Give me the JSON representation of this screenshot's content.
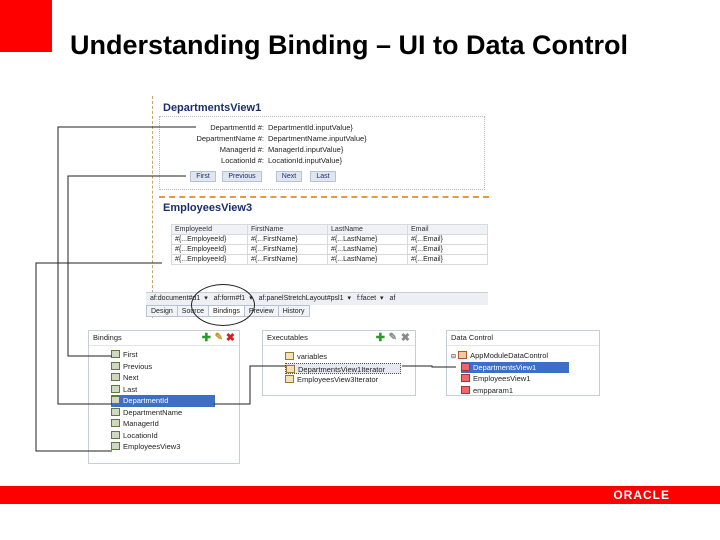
{
  "slide": {
    "title": "Understanding Binding – UI to Data Control",
    "logo": "ORACLE"
  },
  "editor": {
    "departments": {
      "title": "DepartmentsView1",
      "fields": [
        {
          "label": "DepartmentId #:",
          "value": "DepartmentId.inputValue}"
        },
        {
          "label": "DepartmentName #:",
          "value": "DepartmentName.inputValue}"
        },
        {
          "label": "ManagerId #:",
          "value": "ManagerId.inputValue}"
        },
        {
          "label": "LocationId #:",
          "value": "LocationId.inputValue}"
        }
      ],
      "nav_buttons": [
        "First",
        "Previous",
        "Next",
        "Last"
      ]
    },
    "employees": {
      "title": "EmployeesView3",
      "columns": [
        "EmployeeId",
        "FirstName",
        "LastName",
        "Email"
      ],
      "rows": [
        [
          "#{...EmployeeId}",
          "#{...FirstName}",
          "#{...LastName}",
          "#{...Email}"
        ],
        [
          "#{...EmployeeId}",
          "#{...FirstName}",
          "#{...LastName}",
          "#{...Email}"
        ],
        [
          "#{...EmployeeId}",
          "#{...FirstName}",
          "#{...LastName}",
          "#{...Email}"
        ]
      ]
    },
    "breadcrumbs": [
      "af:document#d1",
      "af:form#f1",
      "af:panelStretchLayout#psl1",
      "f:facet",
      "af"
    ],
    "tabs": [
      "Design",
      "Source",
      "Bindings",
      "Preview",
      "History"
    ]
  },
  "bindings_panel": {
    "title": "Bindings",
    "items": [
      "First",
      "Previous",
      "Next",
      "Last",
      "DepartmentId",
      "DepartmentName",
      "ManagerId",
      "LocationId",
      "EmployeesView3"
    ],
    "selected_index": 4
  },
  "executables_panel": {
    "title": "Executables",
    "items": [
      "variables",
      "DepartmentsView1Iterator",
      "EmployeesView3Iterator"
    ],
    "selected_index": 1
  },
  "datacontrol_panel": {
    "title": "Data Control",
    "root": "AppModuleDataControl",
    "items": [
      "DepartmentsView1",
      "EmployeesView1",
      "empparam1"
    ],
    "selected_index": 0
  },
  "colors": {
    "brand_red": "#ff0000",
    "selection_blue": "#3d6fc7",
    "add_green": "#2e9a2e",
    "delete_red": "#d62020"
  }
}
